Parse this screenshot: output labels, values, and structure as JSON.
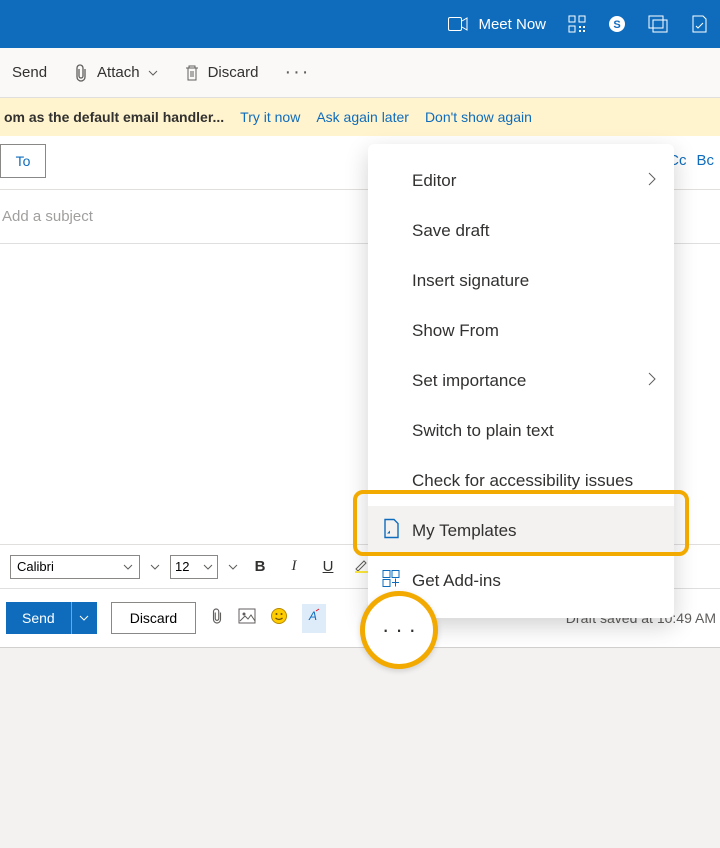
{
  "appbar": {
    "meet_now": "Meet Now"
  },
  "toolbar": {
    "send": "Send",
    "attach": "Attach",
    "discard": "Discard"
  },
  "notice": {
    "msg": "om as the default email handler...",
    "try": "Try it now",
    "later": "Ask again later",
    "dont": "Don't show again"
  },
  "compose": {
    "to_label": "To",
    "cc": "Cc",
    "bcc": "Bc",
    "subject_placeholder": "Add a subject"
  },
  "fmt": {
    "font": "Calibri",
    "size": "12"
  },
  "sendbar": {
    "send": "Send",
    "discard": "Discard",
    "status": "Draft saved at 10:49 AM"
  },
  "menu": {
    "editor": "Editor",
    "save_draft": "Save draft",
    "insert_sig": "Insert signature",
    "show_from": "Show From",
    "set_importance": "Set importance",
    "plain_text": "Switch to plain text",
    "accessibility": "Check for accessibility issues",
    "templates": "My Templates",
    "addins": "Get Add-ins"
  }
}
